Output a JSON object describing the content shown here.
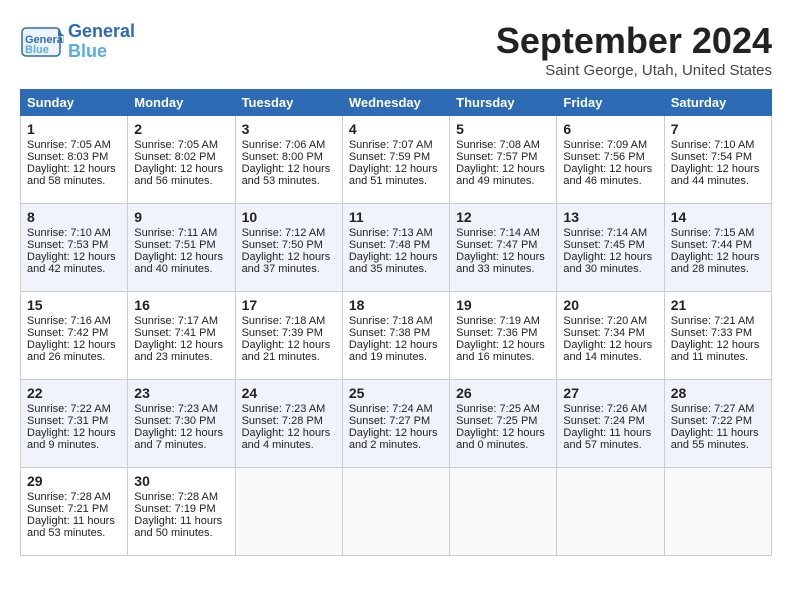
{
  "header": {
    "logo_line1": "General",
    "logo_line2": "Blue",
    "month": "September 2024",
    "location": "Saint George, Utah, United States"
  },
  "days_of_week": [
    "Sunday",
    "Monday",
    "Tuesday",
    "Wednesday",
    "Thursday",
    "Friday",
    "Saturday"
  ],
  "weeks": [
    [
      {
        "day": "1",
        "sunrise": "7:05 AM",
        "sunset": "8:03 PM",
        "daylight": "12 hours and 58 minutes."
      },
      {
        "day": "2",
        "sunrise": "7:05 AM",
        "sunset": "8:02 PM",
        "daylight": "12 hours and 56 minutes."
      },
      {
        "day": "3",
        "sunrise": "7:06 AM",
        "sunset": "8:00 PM",
        "daylight": "12 hours and 53 minutes."
      },
      {
        "day": "4",
        "sunrise": "7:07 AM",
        "sunset": "7:59 PM",
        "daylight": "12 hours and 51 minutes."
      },
      {
        "day": "5",
        "sunrise": "7:08 AM",
        "sunset": "7:57 PM",
        "daylight": "12 hours and 49 minutes."
      },
      {
        "day": "6",
        "sunrise": "7:09 AM",
        "sunset": "7:56 PM",
        "daylight": "12 hours and 46 minutes."
      },
      {
        "day": "7",
        "sunrise": "7:10 AM",
        "sunset": "7:54 PM",
        "daylight": "12 hours and 44 minutes."
      }
    ],
    [
      {
        "day": "8",
        "sunrise": "7:10 AM",
        "sunset": "7:53 PM",
        "daylight": "12 hours and 42 minutes."
      },
      {
        "day": "9",
        "sunrise": "7:11 AM",
        "sunset": "7:51 PM",
        "daylight": "12 hours and 40 minutes."
      },
      {
        "day": "10",
        "sunrise": "7:12 AM",
        "sunset": "7:50 PM",
        "daylight": "12 hours and 37 minutes."
      },
      {
        "day": "11",
        "sunrise": "7:13 AM",
        "sunset": "7:48 PM",
        "daylight": "12 hours and 35 minutes."
      },
      {
        "day": "12",
        "sunrise": "7:14 AM",
        "sunset": "7:47 PM",
        "daylight": "12 hours and 33 minutes."
      },
      {
        "day": "13",
        "sunrise": "7:14 AM",
        "sunset": "7:45 PM",
        "daylight": "12 hours and 30 minutes."
      },
      {
        "day": "14",
        "sunrise": "7:15 AM",
        "sunset": "7:44 PM",
        "daylight": "12 hours and 28 minutes."
      }
    ],
    [
      {
        "day": "15",
        "sunrise": "7:16 AM",
        "sunset": "7:42 PM",
        "daylight": "12 hours and 26 minutes."
      },
      {
        "day": "16",
        "sunrise": "7:17 AM",
        "sunset": "7:41 PM",
        "daylight": "12 hours and 23 minutes."
      },
      {
        "day": "17",
        "sunrise": "7:18 AM",
        "sunset": "7:39 PM",
        "daylight": "12 hours and 21 minutes."
      },
      {
        "day": "18",
        "sunrise": "7:18 AM",
        "sunset": "7:38 PM",
        "daylight": "12 hours and 19 minutes."
      },
      {
        "day": "19",
        "sunrise": "7:19 AM",
        "sunset": "7:36 PM",
        "daylight": "12 hours and 16 minutes."
      },
      {
        "day": "20",
        "sunrise": "7:20 AM",
        "sunset": "7:34 PM",
        "daylight": "12 hours and 14 minutes."
      },
      {
        "day": "21",
        "sunrise": "7:21 AM",
        "sunset": "7:33 PM",
        "daylight": "12 hours and 11 minutes."
      }
    ],
    [
      {
        "day": "22",
        "sunrise": "7:22 AM",
        "sunset": "7:31 PM",
        "daylight": "12 hours and 9 minutes."
      },
      {
        "day": "23",
        "sunrise": "7:23 AM",
        "sunset": "7:30 PM",
        "daylight": "12 hours and 7 minutes."
      },
      {
        "day": "24",
        "sunrise": "7:23 AM",
        "sunset": "7:28 PM",
        "daylight": "12 hours and 4 minutes."
      },
      {
        "day": "25",
        "sunrise": "7:24 AM",
        "sunset": "7:27 PM",
        "daylight": "12 hours and 2 minutes."
      },
      {
        "day": "26",
        "sunrise": "7:25 AM",
        "sunset": "7:25 PM",
        "daylight": "12 hours and 0 minutes."
      },
      {
        "day": "27",
        "sunrise": "7:26 AM",
        "sunset": "7:24 PM",
        "daylight": "11 hours and 57 minutes."
      },
      {
        "day": "28",
        "sunrise": "7:27 AM",
        "sunset": "7:22 PM",
        "daylight": "11 hours and 55 minutes."
      }
    ],
    [
      {
        "day": "29",
        "sunrise": "7:28 AM",
        "sunset": "7:21 PM",
        "daylight": "11 hours and 53 minutes."
      },
      {
        "day": "30",
        "sunrise": "7:28 AM",
        "sunset": "7:19 PM",
        "daylight": "11 hours and 50 minutes."
      },
      null,
      null,
      null,
      null,
      null
    ]
  ],
  "labels": {
    "sunrise_prefix": "Sunrise: ",
    "sunset_prefix": "Sunset: ",
    "daylight_prefix": "Daylight: "
  }
}
